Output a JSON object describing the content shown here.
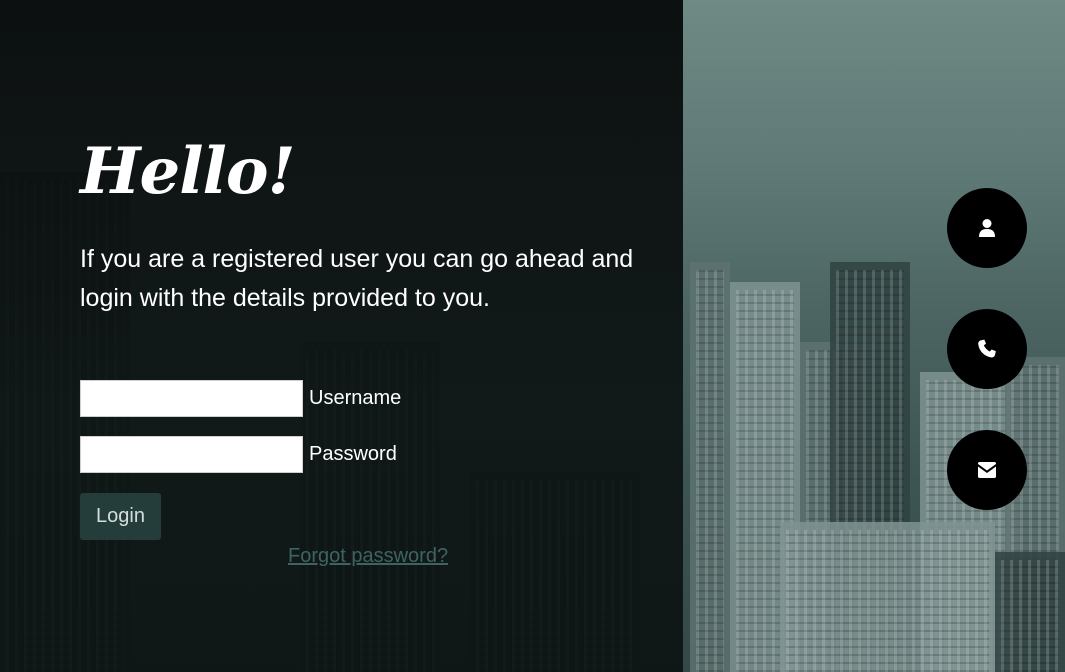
{
  "hero": {
    "title": "Hello!",
    "description": "If you are a registered user you can go ahead and login with the details provided to you."
  },
  "form": {
    "username_label": "Username",
    "username_value": "",
    "password_label": "Password",
    "password_value": "",
    "login_label": "Login",
    "forgot_label": "Forgot password?"
  },
  "side_buttons": [
    {
      "icon": "user-icon"
    },
    {
      "icon": "phone-icon"
    },
    {
      "icon": "envelope-icon"
    }
  ],
  "colors": {
    "login_button": "#243d3b",
    "forgot_link": "#3e6461",
    "circle_button": "#000000"
  }
}
